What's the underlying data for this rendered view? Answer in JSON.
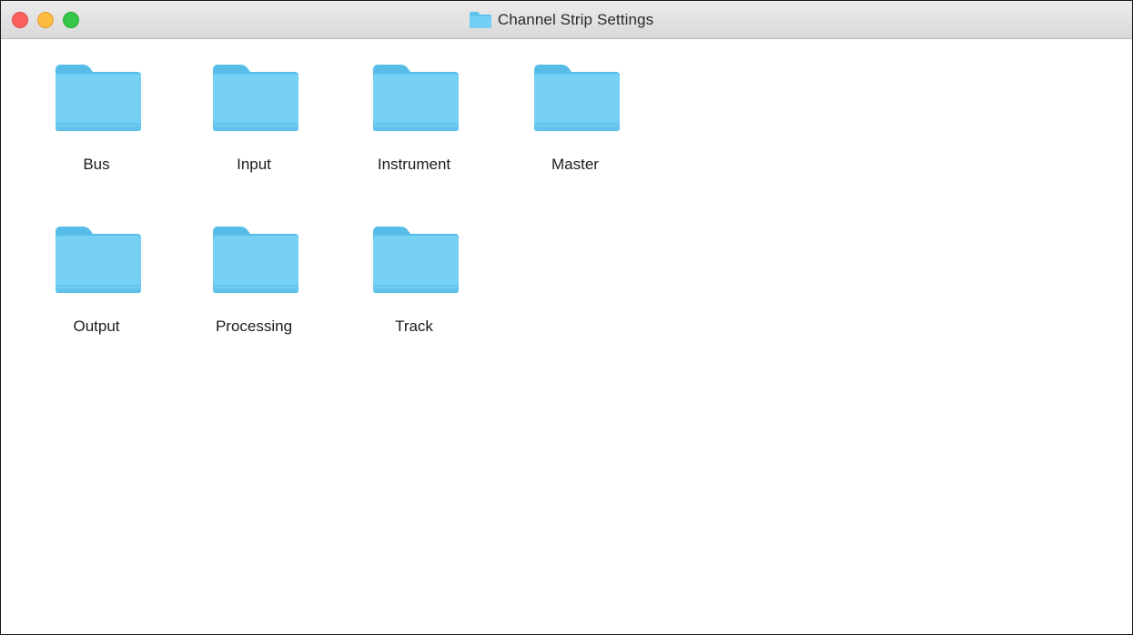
{
  "window": {
    "title": "Channel Strip Settings",
    "title_icon": "folder-icon"
  },
  "controls": {
    "close": "close",
    "minimize": "minimize",
    "zoom": "zoom"
  },
  "colors": {
    "folder_top": "#7fd6f7",
    "folder_body": "#5fc6ef",
    "folder_tab": "#4fb8e6"
  },
  "items": [
    {
      "name": "Bus",
      "icon": "folder-icon"
    },
    {
      "name": "Input",
      "icon": "folder-icon"
    },
    {
      "name": "Instrument",
      "icon": "folder-icon"
    },
    {
      "name": "Master",
      "icon": "folder-icon"
    },
    {
      "name": "Output",
      "icon": "folder-icon"
    },
    {
      "name": "Processing",
      "icon": "folder-icon"
    },
    {
      "name": "Track",
      "icon": "folder-icon"
    }
  ]
}
